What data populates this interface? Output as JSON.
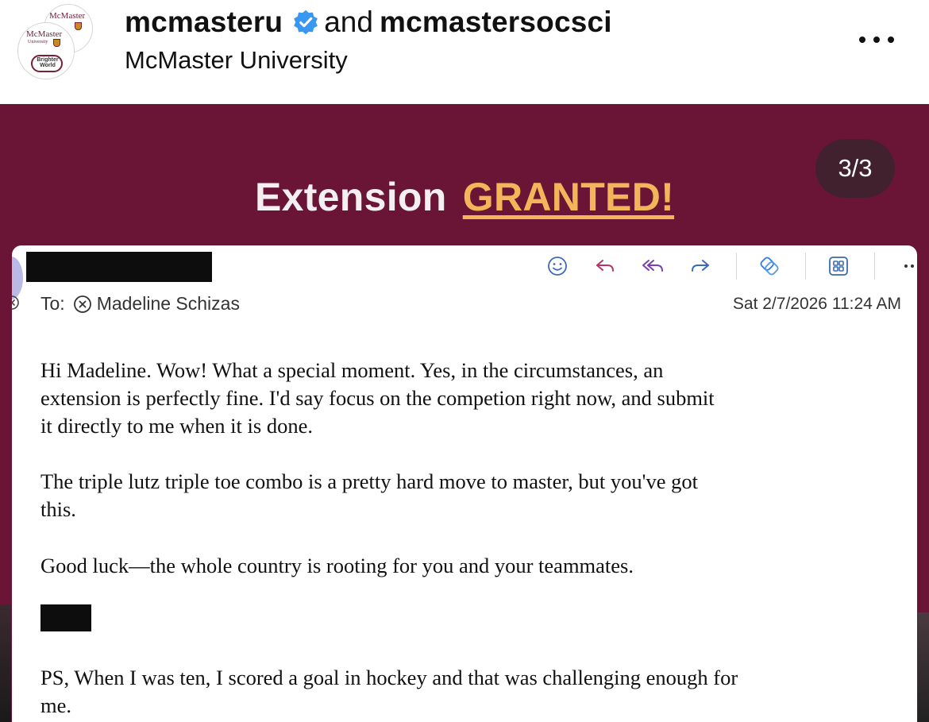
{
  "post": {
    "account_primary": "mcmasteru",
    "account_joiner": "and",
    "account_secondary": "mcmastersocsci",
    "subtitle": "McMaster University",
    "avatar_logo": {
      "wordmark": "McMaster",
      "subline": "University",
      "tagline_1": "Brighter",
      "tagline_2": "World"
    },
    "verified_icon": "verified-badge-icon",
    "more_icon": "more-horizontal-icon"
  },
  "slide": {
    "heading_plain": "Extension",
    "heading_accent": "GRANTED!",
    "counter": "3/3",
    "colors": {
      "background": "#6a1536",
      "accent": "#f2b559",
      "verified": "#3897f0"
    }
  },
  "email": {
    "toolbar_icons": [
      "emoji-icon",
      "reply-icon",
      "reply-all-icon",
      "forward-icon",
      "copilot-icon",
      "apps-icon",
      "more-icon"
    ],
    "to_label": "To:",
    "recipient": "Madeline Schizas",
    "date": "Sat 2/7/2026 11:24 AM",
    "body": [
      "Hi Madeline.  Wow!  What a special moment.   Yes, in the circumstances, an\nextension is perfectly fine.  I'd say focus on the competion right now, and submit\nit directly to me when it is done.",
      "The triple lutz triple toe combo is a pretty hard move to master, but you've got\nthis.",
      "Good luck—the whole country is rooting for you and your teammates.",
      "PS, When I was ten, I scored a goal in hockey and that was challenging enough for\nme."
    ]
  }
}
